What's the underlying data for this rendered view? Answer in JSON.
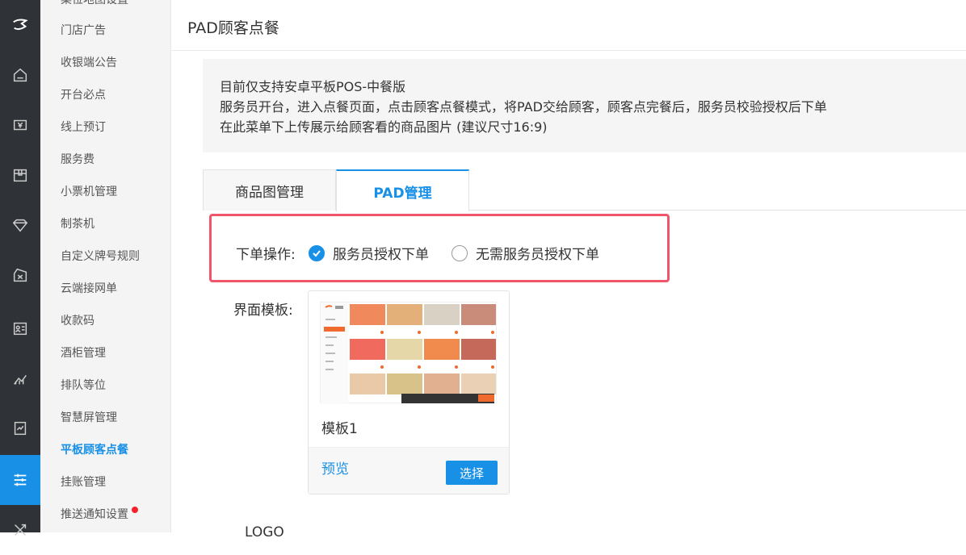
{
  "rail": {
    "icons": [
      "logo-icon",
      "home-icon",
      "cash-icon",
      "box-icon",
      "diamond-icon",
      "coupon-icon",
      "id-card-icon",
      "chart-icon",
      "report-icon",
      "settings-sliders-icon",
      "tools-icon"
    ]
  },
  "submenu": {
    "items": [
      {
        "label": "桌位地图设置"
      },
      {
        "label": "门店广告"
      },
      {
        "label": "收银端公告"
      },
      {
        "label": "开台必点"
      },
      {
        "label": "线上预订"
      },
      {
        "label": "服务费"
      },
      {
        "label": "小票机管理"
      },
      {
        "label": "制茶机"
      },
      {
        "label": "自定义牌号规则"
      },
      {
        "label": "云端接网单"
      },
      {
        "label": "收款码"
      },
      {
        "label": "酒柜管理"
      },
      {
        "label": "排队等位"
      },
      {
        "label": "智慧屏管理"
      },
      {
        "label": "平板顾客点餐"
      },
      {
        "label": "挂账管理"
      },
      {
        "label": "推送通知设置"
      }
    ],
    "active_label": "平板顾客点餐"
  },
  "page": {
    "title": "PAD顾客点餐"
  },
  "notice": {
    "line1": "目前仅支持安卓平板POS-中餐版",
    "line2": "服务员开台，进入点餐页面，点击顾客点餐模式，将PAD交给顾客，顾客点完餐后，服务员校验授权后下单",
    "line3": "在此菜单下上传展示给顾客看的商品图片 (建议尺寸16:9)"
  },
  "tabs": [
    {
      "label": "商品图管理",
      "active": false
    },
    {
      "label": "PAD管理",
      "active": true
    }
  ],
  "order_operation": {
    "label": "下单操作:",
    "options": [
      {
        "label": "服务员授权下单",
        "checked": true
      },
      {
        "label": "无需服务员授权下单",
        "checked": false
      }
    ]
  },
  "template": {
    "label": "界面模板:",
    "card": {
      "name": "模板1",
      "preview_label": "预览",
      "select_label": "选择"
    }
  },
  "logo_section": {
    "label": "LOGO"
  },
  "colors": {
    "accent": "#1890e6",
    "highlight_border": "#f0566a",
    "rail_bg": "#2f3236"
  }
}
